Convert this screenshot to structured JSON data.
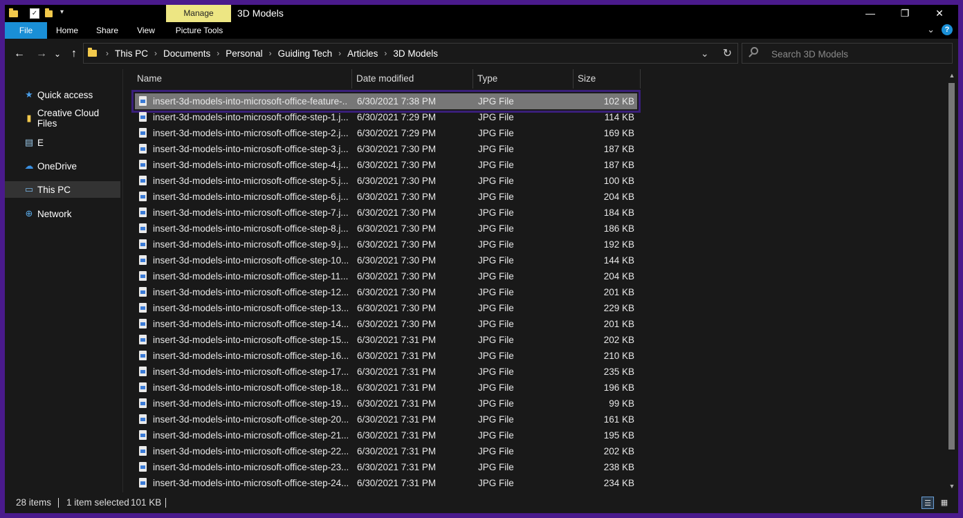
{
  "titlebar": {
    "manage_label": "Manage",
    "window_title": "3D Models",
    "minimize": "—",
    "restore": "❐",
    "close": "✕"
  },
  "ribbon": {
    "tabs": [
      "File",
      "Home",
      "Share",
      "View",
      "Picture Tools"
    ],
    "expand": "⌄",
    "help": "?"
  },
  "nav": {
    "back": "←",
    "forward": "→",
    "recent": "⌄",
    "up": "↑",
    "breadcrumb": [
      "This PC",
      "Documents",
      "Personal",
      "Guiding Tech",
      "Articles",
      "3D Models"
    ],
    "separator": "›",
    "dropdown": "⌄",
    "refresh": "↻"
  },
  "search": {
    "placeholder": "Search 3D Models"
  },
  "navpane": {
    "items": [
      {
        "label": "Quick access",
        "icon": "★",
        "icon_name": "star-icon",
        "color": "#4a9ee8"
      },
      {
        "label": "Creative Cloud Files",
        "icon": "▮",
        "icon_name": "folder-icon",
        "color": "#f2c94c"
      },
      {
        "label": "E",
        "icon": "▤",
        "icon_name": "drive-icon",
        "color": "#9ac8e8"
      },
      {
        "label": "OneDrive",
        "icon": "☁",
        "icon_name": "cloud-icon",
        "color": "#3a8fe0"
      },
      {
        "label": "This PC",
        "icon": "▭",
        "icon_name": "computer-icon",
        "color": "#7ab8e8"
      },
      {
        "label": "Network",
        "icon": "⊕",
        "icon_name": "network-icon",
        "color": "#5aaae8"
      }
    ],
    "selected_index": 4
  },
  "columns": {
    "name": "Name",
    "date": "Date modified",
    "type": "Type",
    "size": "Size",
    "sort_indicator": "^"
  },
  "files": [
    {
      "name": "insert-3d-models-into-microsoft-office-feature-...",
      "date": "6/30/2021 7:38 PM",
      "type": "JPG File",
      "size": "102 KB"
    },
    {
      "name": "insert-3d-models-into-microsoft-office-step-1.j...",
      "date": "6/30/2021 7:29 PM",
      "type": "JPG File",
      "size": "114 KB"
    },
    {
      "name": "insert-3d-models-into-microsoft-office-step-2.j...",
      "date": "6/30/2021 7:29 PM",
      "type": "JPG File",
      "size": "169 KB"
    },
    {
      "name": "insert-3d-models-into-microsoft-office-step-3.j...",
      "date": "6/30/2021 7:30 PM",
      "type": "JPG File",
      "size": "187 KB"
    },
    {
      "name": "insert-3d-models-into-microsoft-office-step-4.j...",
      "date": "6/30/2021 7:30 PM",
      "type": "JPG File",
      "size": "187 KB"
    },
    {
      "name": "insert-3d-models-into-microsoft-office-step-5.j...",
      "date": "6/30/2021 7:30 PM",
      "type": "JPG File",
      "size": "100 KB"
    },
    {
      "name": "insert-3d-models-into-microsoft-office-step-6.j...",
      "date": "6/30/2021 7:30 PM",
      "type": "JPG File",
      "size": "204 KB"
    },
    {
      "name": "insert-3d-models-into-microsoft-office-step-7.j...",
      "date": "6/30/2021 7:30 PM",
      "type": "JPG File",
      "size": "184 KB"
    },
    {
      "name": "insert-3d-models-into-microsoft-office-step-8.j...",
      "date": "6/30/2021 7:30 PM",
      "type": "JPG File",
      "size": "186 KB"
    },
    {
      "name": "insert-3d-models-into-microsoft-office-step-9.j...",
      "date": "6/30/2021 7:30 PM",
      "type": "JPG File",
      "size": "192 KB"
    },
    {
      "name": "insert-3d-models-into-microsoft-office-step-10...",
      "date": "6/30/2021 7:30 PM",
      "type": "JPG File",
      "size": "144 KB"
    },
    {
      "name": "insert-3d-models-into-microsoft-office-step-11...",
      "date": "6/30/2021 7:30 PM",
      "type": "JPG File",
      "size": "204 KB"
    },
    {
      "name": "insert-3d-models-into-microsoft-office-step-12...",
      "date": "6/30/2021 7:30 PM",
      "type": "JPG File",
      "size": "201 KB"
    },
    {
      "name": "insert-3d-models-into-microsoft-office-step-13...",
      "date": "6/30/2021 7:30 PM",
      "type": "JPG File",
      "size": "229 KB"
    },
    {
      "name": "insert-3d-models-into-microsoft-office-step-14...",
      "date": "6/30/2021 7:30 PM",
      "type": "JPG File",
      "size": "201 KB"
    },
    {
      "name": "insert-3d-models-into-microsoft-office-step-15...",
      "date": "6/30/2021 7:31 PM",
      "type": "JPG File",
      "size": "202 KB"
    },
    {
      "name": "insert-3d-models-into-microsoft-office-step-16...",
      "date": "6/30/2021 7:31 PM",
      "type": "JPG File",
      "size": "210 KB"
    },
    {
      "name": "insert-3d-models-into-microsoft-office-step-17...",
      "date": "6/30/2021 7:31 PM",
      "type": "JPG File",
      "size": "235 KB"
    },
    {
      "name": "insert-3d-models-into-microsoft-office-step-18...",
      "date": "6/30/2021 7:31 PM",
      "type": "JPG File",
      "size": "196 KB"
    },
    {
      "name": "insert-3d-models-into-microsoft-office-step-19...",
      "date": "6/30/2021 7:31 PM",
      "type": "JPG File",
      "size": "99 KB"
    },
    {
      "name": "insert-3d-models-into-microsoft-office-step-20...",
      "date": "6/30/2021 7:31 PM",
      "type": "JPG File",
      "size": "161 KB"
    },
    {
      "name": "insert-3d-models-into-microsoft-office-step-21...",
      "date": "6/30/2021 7:31 PM",
      "type": "JPG File",
      "size": "195 KB"
    },
    {
      "name": "insert-3d-models-into-microsoft-office-step-22...",
      "date": "6/30/2021 7:31 PM",
      "type": "JPG File",
      "size": "202 KB"
    },
    {
      "name": "insert-3d-models-into-microsoft-office-step-23...",
      "date": "6/30/2021 7:31 PM",
      "type": "JPG File",
      "size": "238 KB"
    },
    {
      "name": "insert-3d-models-into-microsoft-office-step-24...",
      "date": "6/30/2021 7:31 PM",
      "type": "JPG File",
      "size": "234 KB"
    }
  ],
  "selected_file_index": 0,
  "status": {
    "items": "28 items",
    "selection": "1 item selected",
    "size": "101 KB"
  },
  "views": {
    "details": "☰",
    "tiles": "▦"
  },
  "scroll": {
    "up": "▲",
    "down": "▼"
  },
  "colors": {
    "accent": "#1a8fd6",
    "manage": "#ede683",
    "frame": "#4a1a8c"
  }
}
